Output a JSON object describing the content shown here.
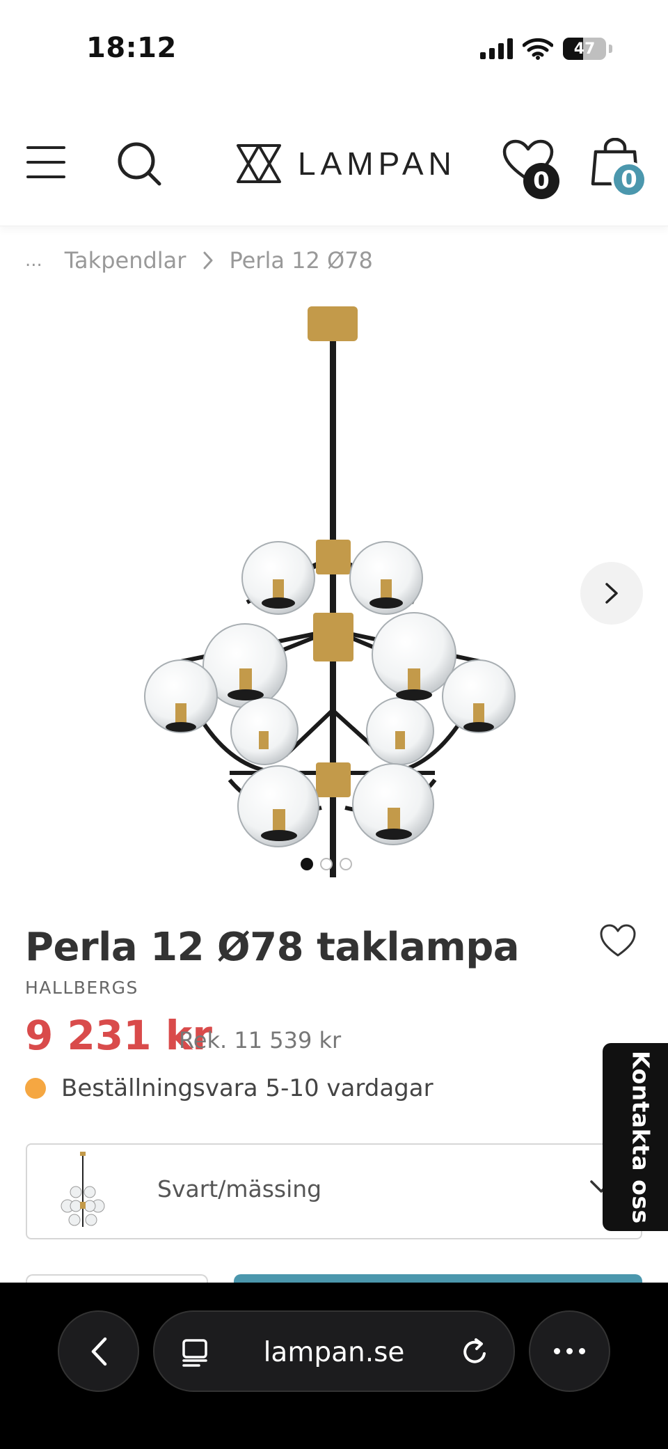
{
  "status_bar": {
    "time": "18:12",
    "battery": "47"
  },
  "header": {
    "logo_text": "LAMPAN",
    "wishlist_count": "0",
    "cart_count": "0",
    "colors": {
      "cart_badge": "#4b97ad",
      "wishlist_badge": "#1a1a1a"
    }
  },
  "breadcrumb": {
    "ellipsis": "...",
    "parent": "Takpendlar",
    "current": "Perla 12 Ø78"
  },
  "gallery": {
    "image_count": 3,
    "active_index": 0
  },
  "product": {
    "title": "Perla 12 Ø78 taklampa",
    "brand": "HALLBERGS",
    "price": "9 231 kr",
    "recommended_price": "Rek. 11 539 kr",
    "availability": "Beställningsvara 5-10 vardagar",
    "colors": {
      "price": "#d94b4b",
      "availability_dot": "#f5a742"
    }
  },
  "variant": {
    "selected": "Svart/mässing"
  },
  "contact_tab": {
    "label": "Kontakta oss"
  },
  "browser": {
    "url": "lampan.se"
  }
}
